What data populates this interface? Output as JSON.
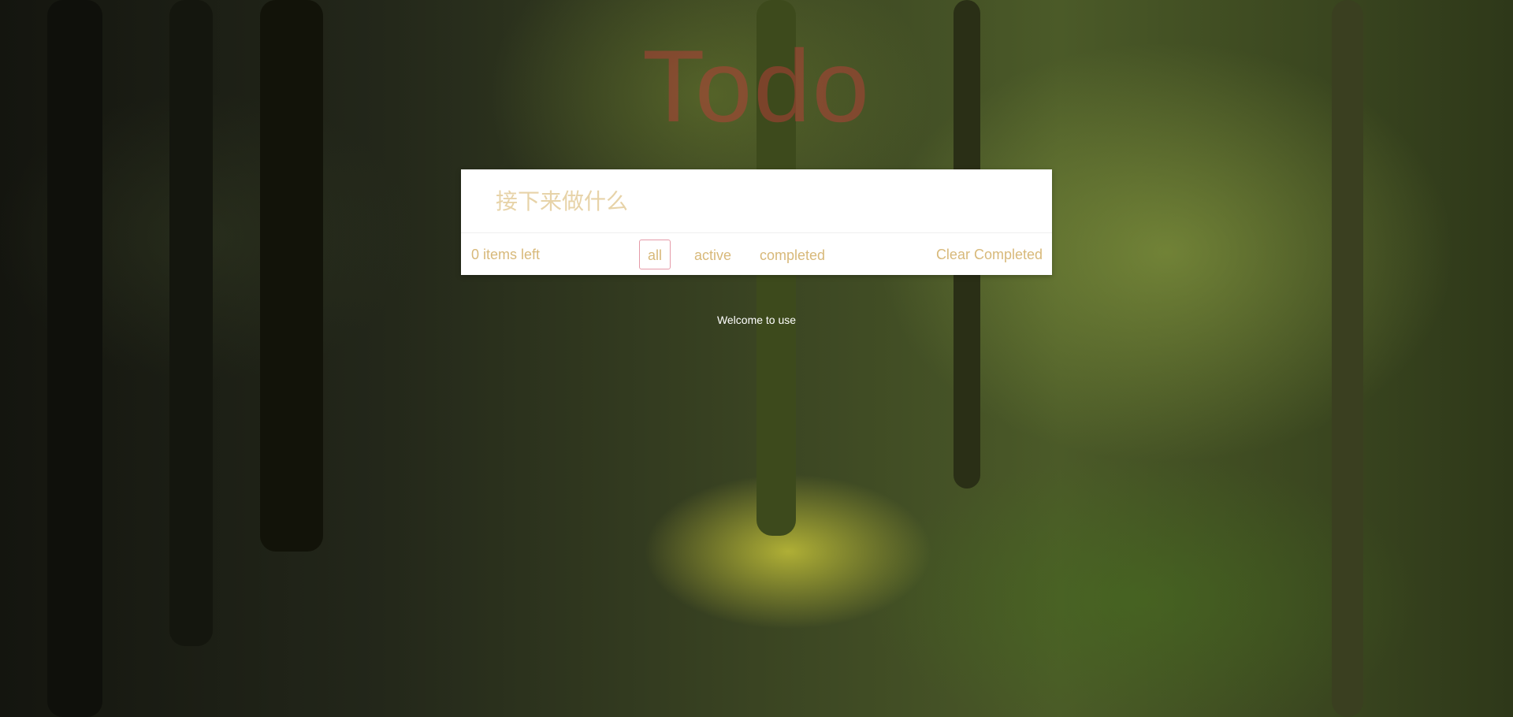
{
  "header": {
    "title": "Todo"
  },
  "new_todo": {
    "placeholder": "接下来做什么",
    "value": ""
  },
  "footer": {
    "items_left": "0 items left",
    "filters": [
      {
        "label": "all",
        "selected": true
      },
      {
        "label": "active",
        "selected": false
      },
      {
        "label": "completed",
        "selected": false
      }
    ],
    "clear_label": "Clear Completed"
  },
  "welcome": "Welcome to use",
  "colors": {
    "title": "#c83c3c",
    "footer_text": "#d8b97a",
    "placeholder": "#e7d3a8",
    "selected_filter_border": "#e59aa8"
  }
}
